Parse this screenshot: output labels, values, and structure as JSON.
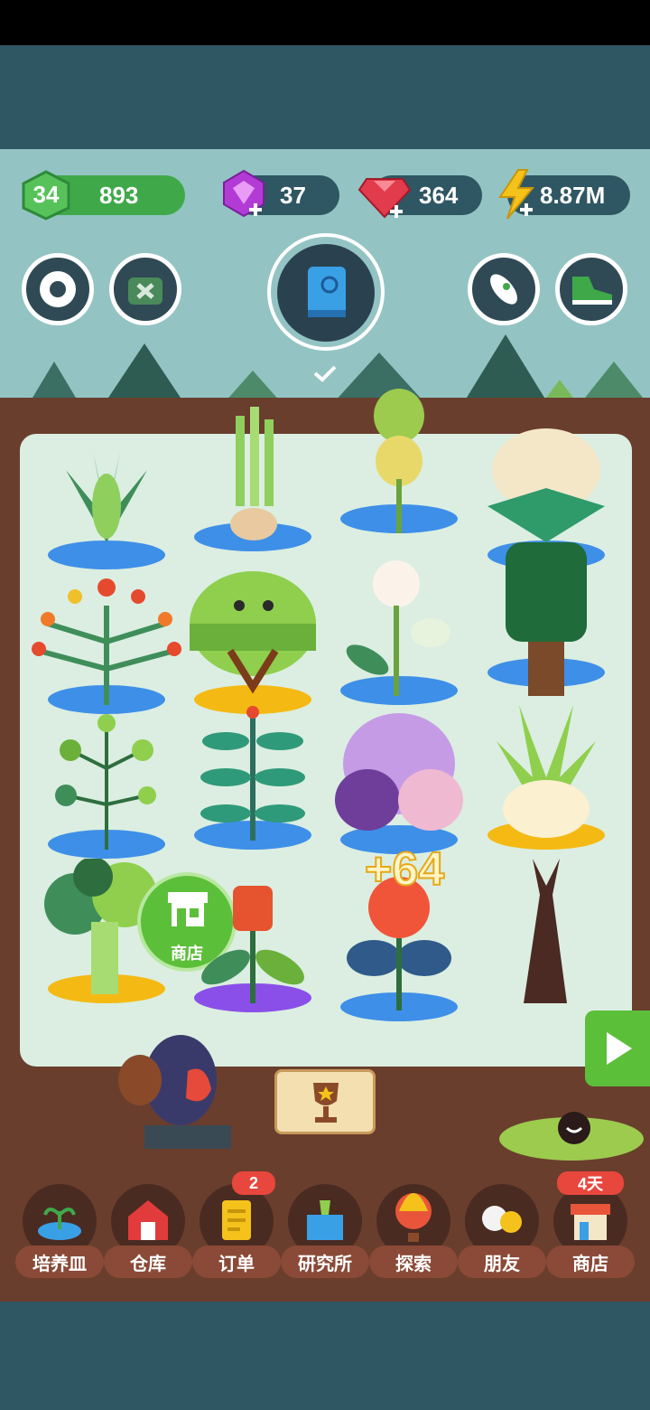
{
  "resources": {
    "level": "34",
    "leaves": "893",
    "gems": "37",
    "rubies": "364",
    "energy": "8.87M"
  },
  "board": {
    "floating_gain": "+64",
    "shop_button_label": "商店"
  },
  "nav": {
    "items": [
      {
        "label": "培养皿"
      },
      {
        "label": "仓库"
      },
      {
        "label": "订单",
        "badge": "2"
      },
      {
        "label": "研究所"
      },
      {
        "label": "探索"
      },
      {
        "label": "朋友"
      },
      {
        "label": "商店",
        "badge": "4天"
      }
    ]
  },
  "colors": {
    "header": "#2f5663",
    "sky": "#93c4c3",
    "soil": "#6a3e2d",
    "board": "#dbeee1",
    "level_green": "#3fa94a",
    "gem_purple": "#b23bd6",
    "ruby_red": "#e23b4b",
    "energy_yellow": "#f5c21b",
    "shop_green": "#5cbf3a",
    "badge_red": "#e8473d"
  }
}
